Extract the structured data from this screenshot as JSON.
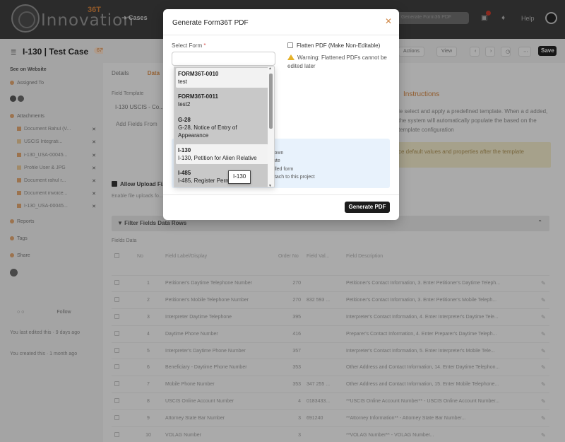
{
  "topbar": {
    "logo_text": "Innovation",
    "logo_badge": "36T",
    "nav_cases": "Cases",
    "search_placeholder": "Generate Form36 PDF",
    "help": "Help"
  },
  "sidebar": {
    "case_title": "I-130 | Test Case",
    "case_badge": "67%",
    "see_website": "See on Website",
    "assigned": "Assigned To",
    "attachments": "Attachments",
    "files": [
      {
        "name": "Document Rahul (V..."
      },
      {
        "name": "USCIS Integrati..."
      },
      {
        "name": "i-130_USA-00045..."
      },
      {
        "name": "Profile User & JPG"
      },
      {
        "name": "Document rahul r..."
      },
      {
        "name": "Document invoice..."
      },
      {
        "name": "I-130_USA-00045..."
      }
    ],
    "reports": "Reports",
    "tags": "Tags",
    "share": "Share",
    "follow": "Follow",
    "note1": "You last edited this · 9 days ago",
    "note2": "You created this · 1 month ago"
  },
  "header": {
    "actions": "Actions",
    "view": "View",
    "save": "Save"
  },
  "main": {
    "tabs": [
      "Details",
      "Data"
    ],
    "field_template_label": "Field Template",
    "template_value": "I-130 USCIS - Co...",
    "add_fields": "Add Fields From",
    "instructions_title": "Instructions",
    "instructions_body": "le select and apply a predefined template. When a d added, the system will automatically populate the based on the template configuration",
    "yellow_note": "ce default values and properties after the template",
    "allow_upload": "Allow Upload Fi...",
    "enable_text": "Enable file uploads fo... files directly from the...",
    "filter_title": "Filter Fields Data Rows",
    "fields_data": "Fields Data",
    "columns": [
      "No",
      "Field Label/Display",
      "Order No",
      "Field Val...",
      "Field Description"
    ],
    "rows": [
      {
        "no": "1",
        "label": "Petitioner's Daytime Telephone Number",
        "order": "270",
        "value": "",
        "desc": "Petitioner's Contact Information, 3. Enter Petitioner's Daytime Teleph..."
      },
      {
        "no": "2",
        "label": "Petitioner's Mobile Telephone Number",
        "order": "270",
        "value": "832 593 ...",
        "desc": "Petitioner's Contact Information, 3. Enter Petitioner's Mobile Teleph..."
      },
      {
        "no": "3",
        "label": "Interpreter Daytime Telephone",
        "order": "395",
        "value": "",
        "desc": "Interpreter's Contact Information, 4. Enter Interpreter's Daytime Tele..."
      },
      {
        "no": "4",
        "label": "Daytime Phone Number",
        "order": "416",
        "value": "",
        "desc": "Preparer's Contact Information, 4. Enter Preparer's Daytime Teleph..."
      },
      {
        "no": "5",
        "label": "Interpreter's Daytime Phone Number",
        "order": "357",
        "value": "",
        "desc": "Interpreter's Contact Information, 5. Enter Interpreter's Mobile Tele..."
      },
      {
        "no": "6",
        "label": "Beneficiary - Daytime Phone Number",
        "order": "353",
        "value": "",
        "desc": "Other Address and Contact Information, 14. Enter Daytime Telephon..."
      },
      {
        "no": "7",
        "label": "Mobile Phone Number",
        "order": "353",
        "value": "347 255 ...",
        "desc": "Other Address and Contact Information, 15. Enter Mobile Telephone..."
      },
      {
        "no": "8",
        "label": "USCIS Online Account Number",
        "order": "4",
        "value": "0183433...",
        "desc": "**USCIS Online Account Number** - USCIS Online Account Number..."
      },
      {
        "no": "9",
        "label": "Attorney State Bar Number",
        "order": "3",
        "value": "691240",
        "desc": "**Attorney Information** - Attorney State Bar Number..."
      },
      {
        "no": "10",
        "label": "VOLAG Number",
        "order": "3",
        "value": "",
        "desc": "**VOLAG Number** - VOLAG Number..."
      }
    ]
  },
  "modal": {
    "title": "Generate Form36T PDF",
    "select_label": "Select Form",
    "required_mark": "*",
    "flatten_label": "Flatten PDF (Make Non-Editable)",
    "warning": "Warning: Flattened PDFs cannot be edited later",
    "info_lines": [
      "lown",
      "ate",
      "illed form",
      "ttach to this project"
    ],
    "generate_button": "Generate PDF",
    "tooltip": "I-130",
    "options": [
      {
        "title": "FORM36T-0010",
        "desc": "test"
      },
      {
        "title": "FORM36T-0011",
        "desc": "test2"
      },
      {
        "title": "G-28",
        "desc": "G-28, Notice of Entry of Appearance"
      },
      {
        "title": "I-130",
        "desc": "I-130, Petition for Alien Relative"
      },
      {
        "title": "I-485",
        "desc": "I-485, Register Perm..."
      }
    ]
  }
}
